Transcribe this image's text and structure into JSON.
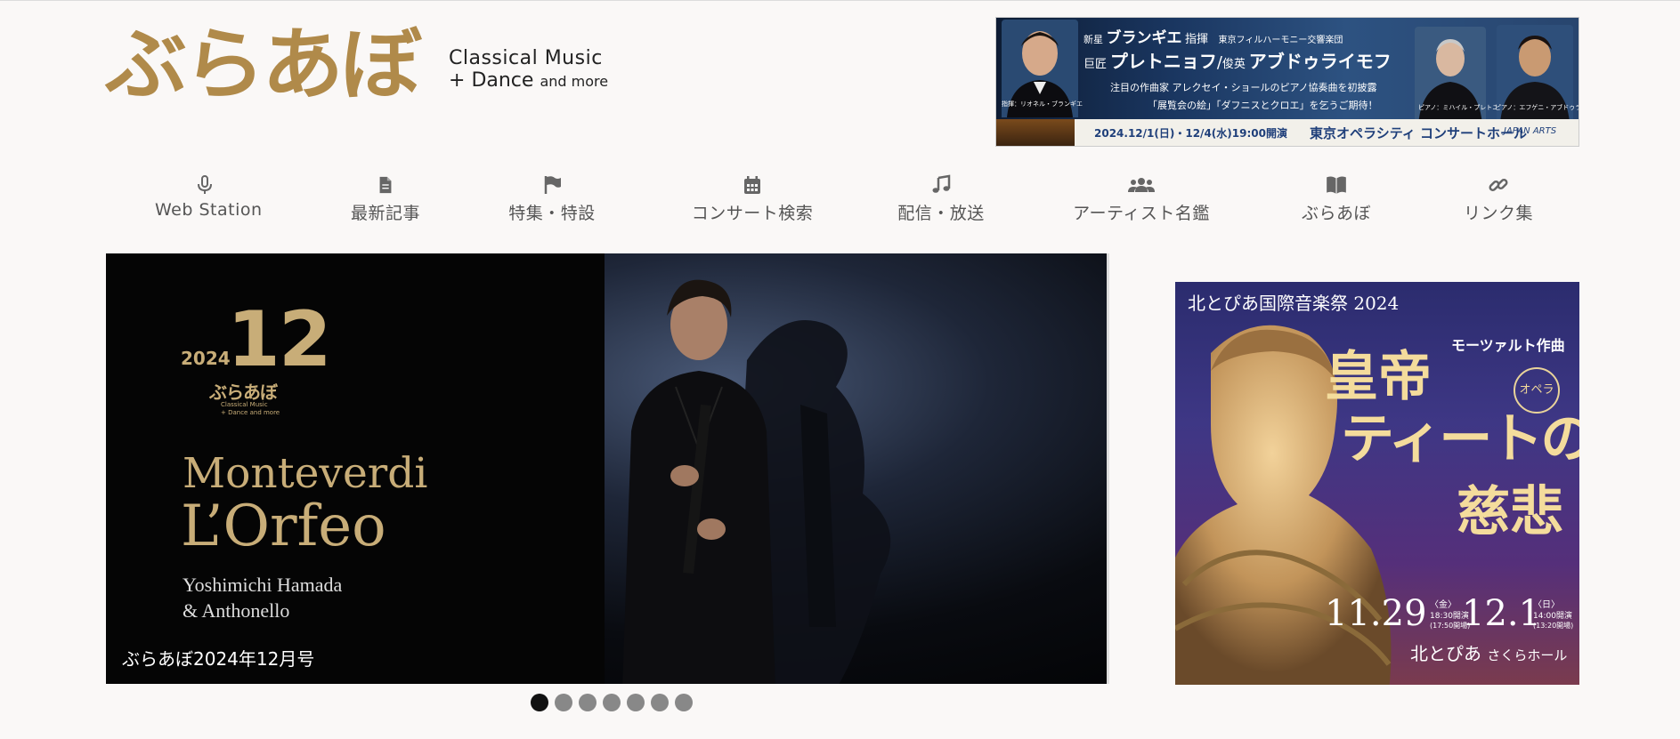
{
  "logo": {
    "mark": "ぶらあぼ",
    "line1": "Classical Music",
    "line2": "+ Dance",
    "line2_small": "and more"
  },
  "top_banner": {
    "line1_small": "新星",
    "line1_name": "ブランギエ",
    "line1_role": "指揮",
    "line1_org": "東京フィルハーモニー交響楽団",
    "line2_a": "巨匠",
    "line2_name_a": "プレトニョフ",
    "line2_sep": "/",
    "line2_b": "俊英",
    "line2_name_b": "アブドゥライモフ",
    "line3": "注目の作曲家 アレクセイ・ショールのピアノ協奏曲を初披露",
    "line4": "「展覧会の絵」「ダフニスとクロエ」を乞うご期待！",
    "caption_left": "指揮：リオネル・ブランギエ",
    "caption_mid": "ピアノ：ミハイル・プレトニョフ",
    "caption_right": "ピアノ：エフゲニ・アブドゥライモフ",
    "dates": "2024.12/1(日)・12/4(水)19:00開演",
    "venue": "東京オペラシティ コンサートホール",
    "presenter": "JAPAN ARTS"
  },
  "nav": [
    {
      "label": "Web Station",
      "icon": "microphone-icon"
    },
    {
      "label": "最新記事",
      "icon": "document-icon"
    },
    {
      "label": "特集・特設",
      "icon": "flag-icon"
    },
    {
      "label": "コンサート検索",
      "icon": "calendar-icon"
    },
    {
      "label": "配信・放送",
      "icon": "music-note-icon"
    },
    {
      "label": "アーティスト名鑑",
      "icon": "users-icon"
    },
    {
      "label": "ぶらあぼ",
      "icon": "book-icon"
    },
    {
      "label": "リンク集",
      "icon": "link-icon"
    }
  ],
  "hero": {
    "year": "2024",
    "month": "12",
    "mini_logo": "ぶらあぼ",
    "mini_sub1": "Classical Music",
    "mini_sub2": "+ Dance and more",
    "title1": "Monteverdi",
    "title2": "L’Orfeo",
    "sub1": "Yoshimichi Hamada",
    "sub2": "& Anthonello",
    "caption": "ぶらあぼ2024年12月号"
  },
  "slider": {
    "dot_count": 7,
    "active_index": 0
  },
  "side_ad": {
    "festival": "北とぴあ国際音楽祭 2024",
    "composer": "モーツァルト作曲",
    "badge": "オペラ",
    "title1": "皇帝",
    "title2": "ティートの",
    "title3": "慈悲",
    "date1": "11.29",
    "date1_day": "〈金〉",
    "date1_time": "18:30開演",
    "date1_door": "(17:50開場)",
    "date2": "12.1",
    "date2_day": "〈日〉",
    "date2_time": "14:00開演",
    "date2_door": "(13:20開場)",
    "venue": "北とぴあ",
    "hall": "さくらホール"
  },
  "colors": {
    "brand_gold": "#b08a4a",
    "nav_text": "#555555",
    "dot_active": "#111111",
    "dot_inactive": "#888888"
  }
}
